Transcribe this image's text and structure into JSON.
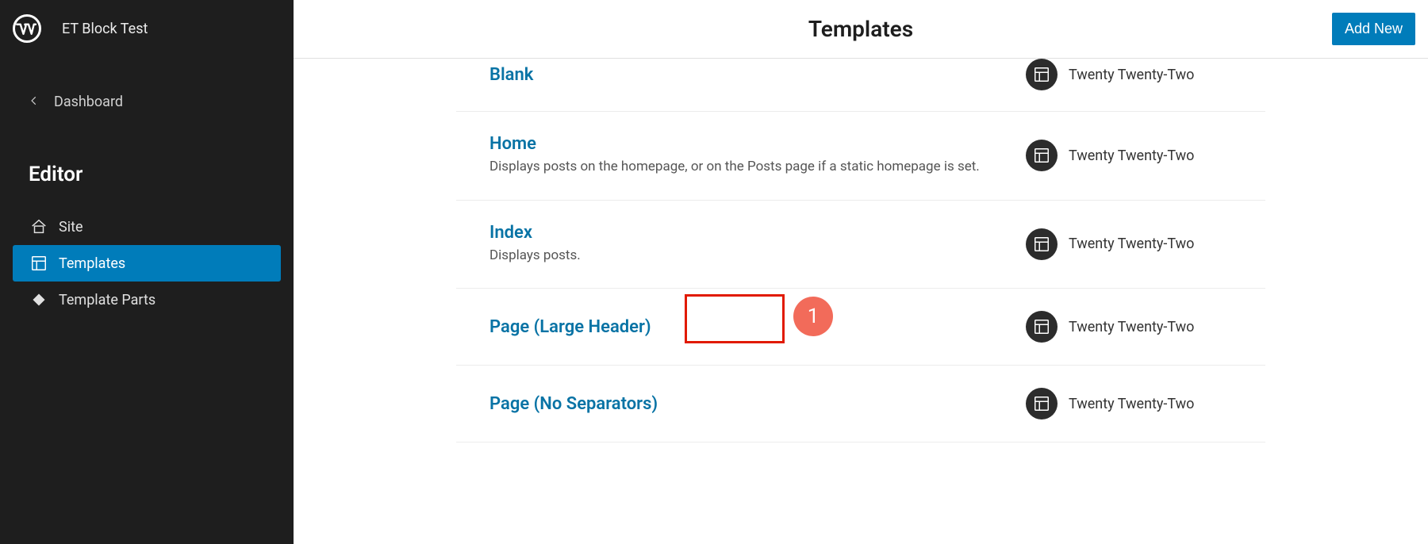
{
  "sidebar": {
    "site_title": "ET Block Test",
    "back_label": "Dashboard",
    "editor_heading": "Editor",
    "nav": [
      {
        "id": "site",
        "label": "Site",
        "icon": "home-icon",
        "active": false
      },
      {
        "id": "templates",
        "label": "Templates",
        "icon": "layout-icon",
        "active": true
      },
      {
        "id": "template-parts",
        "label": "Template Parts",
        "icon": "diamond-icon",
        "active": false
      }
    ]
  },
  "header": {
    "page_title": "Templates",
    "add_new_label": "Add New"
  },
  "templates": [
    {
      "id": "blank",
      "title": "Blank",
      "description": "",
      "theme": "Twenty Twenty-Two"
    },
    {
      "id": "home",
      "title": "Home",
      "description": "Displays posts on the homepage, or on the Posts page if a static homepage is set.",
      "theme": "Twenty Twenty-Two"
    },
    {
      "id": "index",
      "title": "Index",
      "description": "Displays posts.",
      "theme": "Twenty Twenty-Two"
    },
    {
      "id": "page-large-header",
      "title": "Page (Large Header)",
      "description": "",
      "theme": "Twenty Twenty-Two"
    },
    {
      "id": "page-no-separators",
      "title": "Page (No Separators)",
      "description": "",
      "theme": "Twenty Twenty-Two"
    }
  ],
  "annotation": {
    "badge_text": "1"
  },
  "colors": {
    "accent": "#007cba",
    "link": "#0873a5",
    "sidebar_bg": "#1e1e1e",
    "badge": "#f26b5a",
    "annot_border": "#e11a00"
  }
}
